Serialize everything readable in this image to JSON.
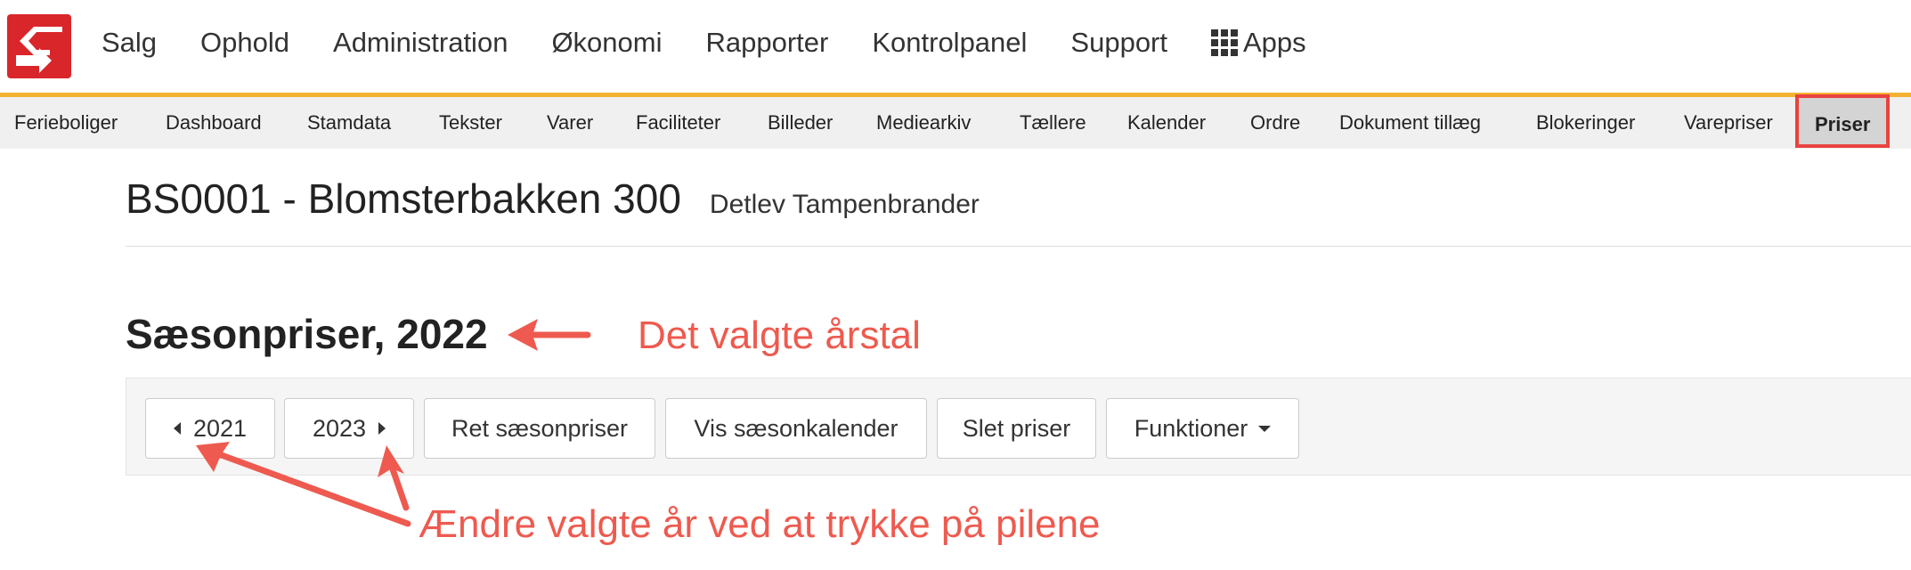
{
  "topnav": {
    "items": [
      {
        "label": "Salg"
      },
      {
        "label": "Ophold"
      },
      {
        "label": "Administration"
      },
      {
        "label": "Økonomi"
      },
      {
        "label": "Rapporter"
      },
      {
        "label": "Kontrolpanel"
      },
      {
        "label": "Support"
      }
    ],
    "apps_label": "Apps"
  },
  "subnav": {
    "items": [
      {
        "label": "Ferieboliger"
      },
      {
        "label": "Dashboard"
      },
      {
        "label": "Stamdata"
      },
      {
        "label": "Tekster"
      },
      {
        "label": "Varer"
      },
      {
        "label": "Faciliteter"
      },
      {
        "label": "Billeder"
      },
      {
        "label": "Mediearkiv"
      },
      {
        "label": "Tællere"
      },
      {
        "label": "Kalender"
      },
      {
        "label": "Ordre"
      },
      {
        "label": "Dokument tillæg"
      },
      {
        "label": "Blokeringer"
      },
      {
        "label": "Varepriser"
      },
      {
        "label": "Priser"
      }
    ],
    "active": "Priser"
  },
  "header": {
    "property_title": "BS0001 - Blomsterbakken 300",
    "owner": "Detlev Tampenbrander"
  },
  "season": {
    "title": "Sæsonpriser, 2022"
  },
  "toolbar": {
    "prev_year": "2021",
    "next_year": "2023",
    "edit_label": "Ret sæsonpriser",
    "calendar_label": "Vis sæsonkalender",
    "delete_label": "Slet priser",
    "functions_label": "Funktioner"
  },
  "annotations": {
    "year_note": "Det valgte årstal",
    "arrows_note": "Ændre valgte år ved at trykke på pilene"
  },
  "colors": {
    "brand_red": "#d9262b",
    "accent_orange": "#f4b233",
    "annotation_red": "#ee5a4f"
  }
}
